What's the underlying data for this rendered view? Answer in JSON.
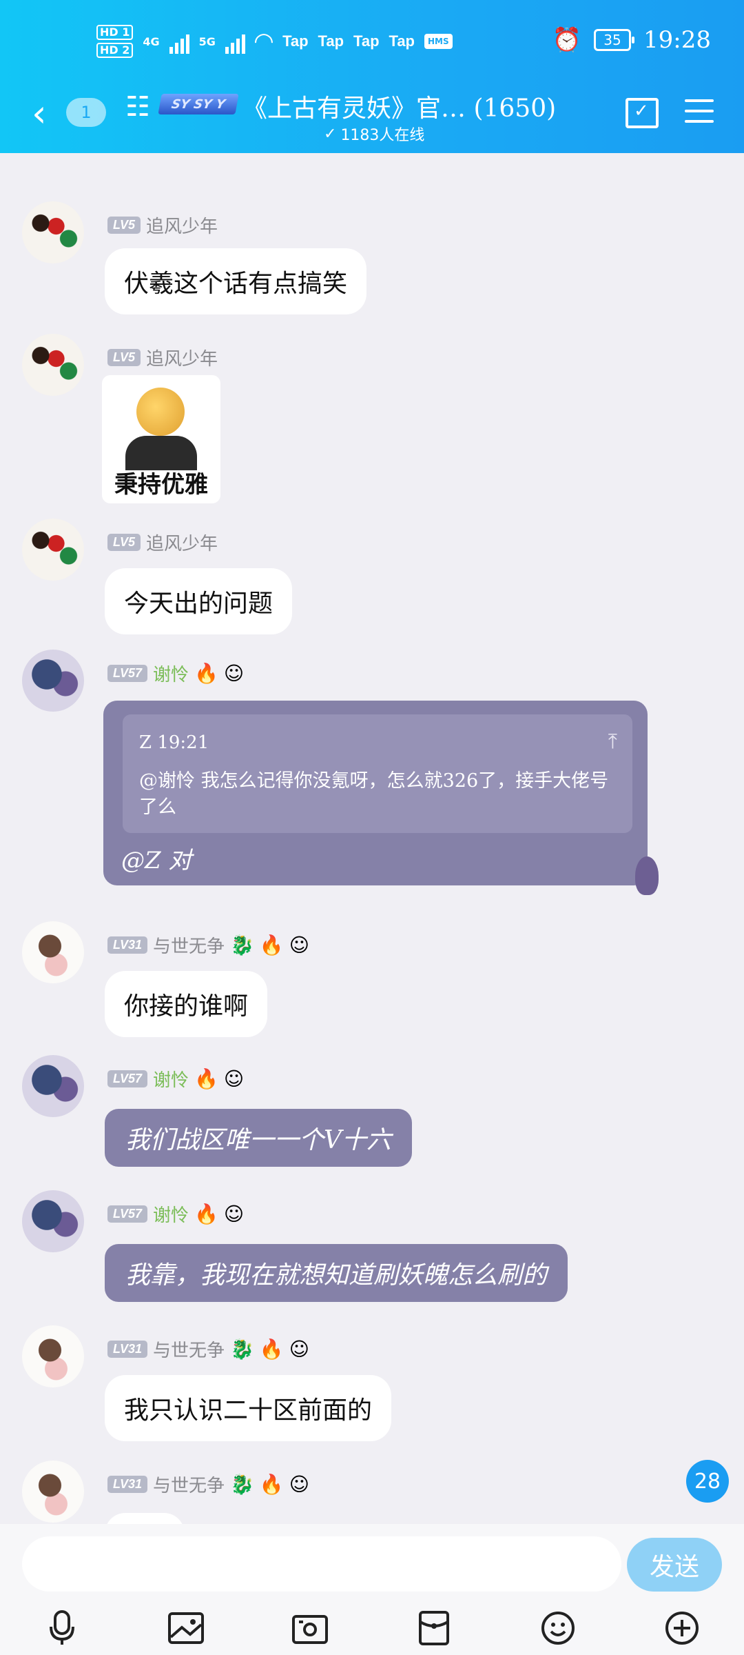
{
  "status_bar": {
    "hd1": "HD 1",
    "hd2": "HD 2",
    "net1": "4G",
    "net2": "5G",
    "tap_labels": [
      "Tap",
      "Tap",
      "Tap",
      "Tap"
    ],
    "hms": "HMS",
    "battery": "35",
    "time": "19:28"
  },
  "header": {
    "back_label": "<",
    "unread_count": "1",
    "logo_text": "SY SY Y",
    "title": "《上古有灵妖》官… (1650)",
    "online": "1183人在线"
  },
  "messages": [
    {
      "level": "LV5",
      "nick": "追风少年",
      "text": "伏羲这个话有点搞笑"
    },
    {
      "level": "LV5",
      "nick": "追风少年",
      "sticker_caption": "秉持优雅"
    },
    {
      "level": "LV5",
      "nick": "追风少年",
      "text": "今天出的问题"
    },
    {
      "level": "LV57",
      "nick": "谢怜",
      "quote_head": "Z  19:21",
      "quote_body": "@谢怜  我怎么记得你没氪呀，怎么就326了，接手大佬号了么",
      "text": "@Z 对"
    },
    {
      "level": "LV31",
      "nick": "与世无争",
      "text": "你接的谁啊"
    },
    {
      "level": "LV57",
      "nick": "谢怜",
      "text": "我们战区唯一一个V十六"
    },
    {
      "level": "LV57",
      "nick": "谢怜",
      "text": "我靠，我现在就想知道刷妖魄怎么刷的"
    },
    {
      "level": "LV31",
      "nick": "与世无争",
      "text": "我只认识二十区前面的"
    },
    {
      "level": "LV31",
      "nick": "与世无争",
      "text": ""
    }
  ],
  "unread_badge": "28",
  "input": {
    "placeholder": "",
    "send_label": "发送"
  },
  "toolbar_icons": [
    "microphone-icon",
    "image-icon",
    "camera-icon",
    "red-packet-icon",
    "emoji-icon",
    "plus-icon"
  ]
}
